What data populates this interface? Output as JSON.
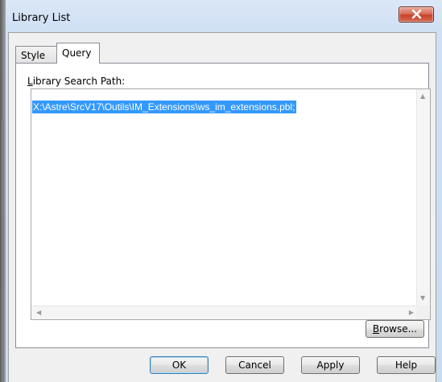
{
  "window": {
    "title": "Library List"
  },
  "tabs": [
    {
      "label": "Style",
      "selected": false
    },
    {
      "label": "Query",
      "selected": true
    }
  ],
  "query": {
    "field_label_mnemonic": "L",
    "field_label_rest": "ibrary Search Path:",
    "search_path": "X:\\Astre\\SrcV17\\Outils\\IM_Extensions\\ws_im_extensions.pbl;"
  },
  "buttons": {
    "browse_mnemonic": "B",
    "browse_rest": "rowse...",
    "ok": "OK",
    "cancel": "Cancel",
    "apply": "Apply",
    "help": "Help"
  },
  "icons": {
    "close": "close-icon",
    "scroll_up": "scroll-up-arrow-icon",
    "scroll_down": "scroll-down-arrow-icon",
    "scroll_left": "scroll-left-arrow-icon",
    "scroll_right": "scroll-right-arrow-icon"
  },
  "colors": {
    "selection": "#3399ff",
    "close_button": "#c7432b"
  }
}
